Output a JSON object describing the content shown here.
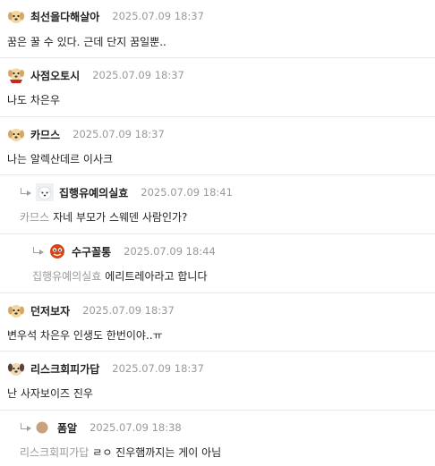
{
  "comments": [
    {
      "nick": "최선을다해살아",
      "date": "2025.07.09 18:37",
      "text": "꿈은 꿀 수 있다. 근데 단지 꿈일뿐..",
      "mention": "",
      "avatar": "dog-tan"
    },
    {
      "nick": "사점오토시",
      "date": "2025.07.09 18:37",
      "text": "나도 차은우",
      "mention": "",
      "avatar": "dog-scarf"
    },
    {
      "nick": "카므스",
      "date": "2025.07.09 18:37",
      "text": "나는 알렉산데르 이사크",
      "mention": "",
      "avatar": "dog-tan"
    },
    {
      "nick": "집행유예의실효",
      "date": "2025.07.09 18:41",
      "text": "자네 부모가 스웨덴 사람인가?",
      "mention": "카므스",
      "avatar": "dog-white"
    },
    {
      "nick": "수구꼴통",
      "date": "2025.07.09 18:44",
      "text": "에리트레아라고 합니다",
      "mention": "집행유예의실효",
      "avatar": "mascot-red"
    },
    {
      "nick": "던저보자",
      "date": "2025.07.09 18:37",
      "text": "변우석 차은우 인생도 한번이야..ㅠ",
      "mention": "",
      "avatar": "dog-tan"
    },
    {
      "nick": "리스크회피가답",
      "date": "2025.07.09 18:37",
      "text": "난 사자보이즈 진우",
      "mention": "",
      "avatar": "dog-dark"
    },
    {
      "nick": "폼알",
      "date": "2025.07.09 18:38",
      "text": "ㄹㅇ 진우햄까지는 게이 아님",
      "mention": "리스크회피가답",
      "avatar": "circle-tan"
    }
  ]
}
